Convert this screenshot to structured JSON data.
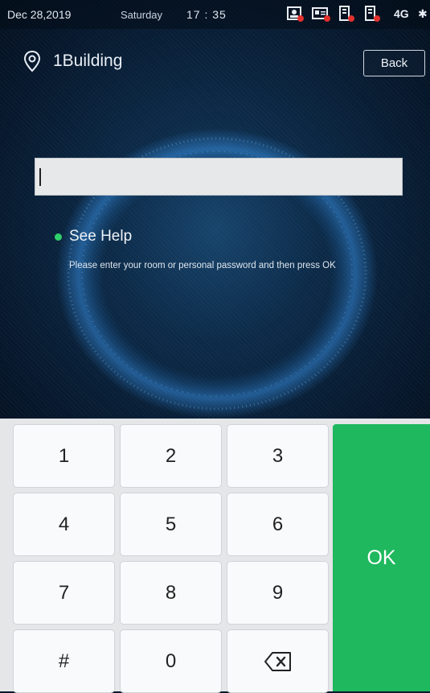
{
  "status_bar": {
    "date": "Dec 28,2019",
    "day": "Saturday",
    "time": "17 : 35",
    "network": "4G",
    "icons": [
      "camera-error-icon",
      "id-card-error-icon",
      "lock-error-icon",
      "lock2-error-icon",
      "network-4g-icon",
      "bluetooth-icon"
    ]
  },
  "header": {
    "location_icon": "location-pin-icon",
    "building_name": "1Building",
    "back_label": "Back"
  },
  "password_field": {
    "value": "",
    "placeholder": ""
  },
  "help": {
    "label": "See Help",
    "hint": "Please enter your room or personal password and then press OK"
  },
  "keypad": {
    "keys": [
      "1",
      "2",
      "3",
      "4",
      "5",
      "6",
      "7",
      "8",
      "9",
      "#",
      "0",
      "⌫"
    ],
    "delete_icon": "backspace-icon",
    "ok_label": "OK"
  },
  "colors": {
    "accent_green": "#1fb85e",
    "status_dot": "#2fd06a",
    "error_red": "#e2312d"
  }
}
